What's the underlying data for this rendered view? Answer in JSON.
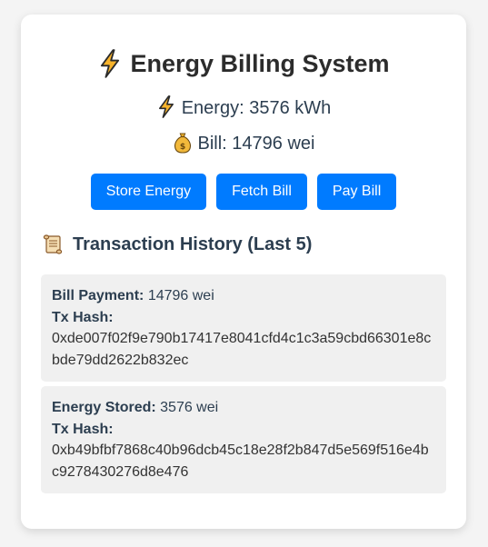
{
  "app": {
    "title": "Energy Billing System",
    "title_icon": "lightning-bolt-icon"
  },
  "stats": {
    "energy_label": "Energy:",
    "energy_value": "3576 kWh",
    "energy_icon": "lightning-bolt-icon",
    "bill_label": "Bill:",
    "bill_value": "14796 wei",
    "bill_icon": "money-bag-icon"
  },
  "actions": {
    "store_energy": "Store Energy",
    "fetch_bill": "Fetch Bill",
    "pay_bill": "Pay Bill"
  },
  "history": {
    "heading": "Transaction History (Last 5)",
    "heading_icon": "scroll-icon",
    "hash_label": "Tx Hash:",
    "items": [
      {
        "type": "Bill Payment:",
        "amount": "14796 wei",
        "hash": "0xde007f02f9e790b17417e8041cfd4c1c3a59cbd66301e8cbde79dd2622b832ec"
      },
      {
        "type": "Energy Stored:",
        "amount": "3576 wei",
        "hash": "0xb49bfbf7868c40b96dcb45c18e28f2b847d5e569f516e4bc9278430276d8e476"
      }
    ]
  },
  "colors": {
    "primary": "#007bff",
    "bolt": "#f7b32b",
    "text": "#2c3e50",
    "card_bg": "#ffffff",
    "item_bg": "#f0f0f0"
  }
}
